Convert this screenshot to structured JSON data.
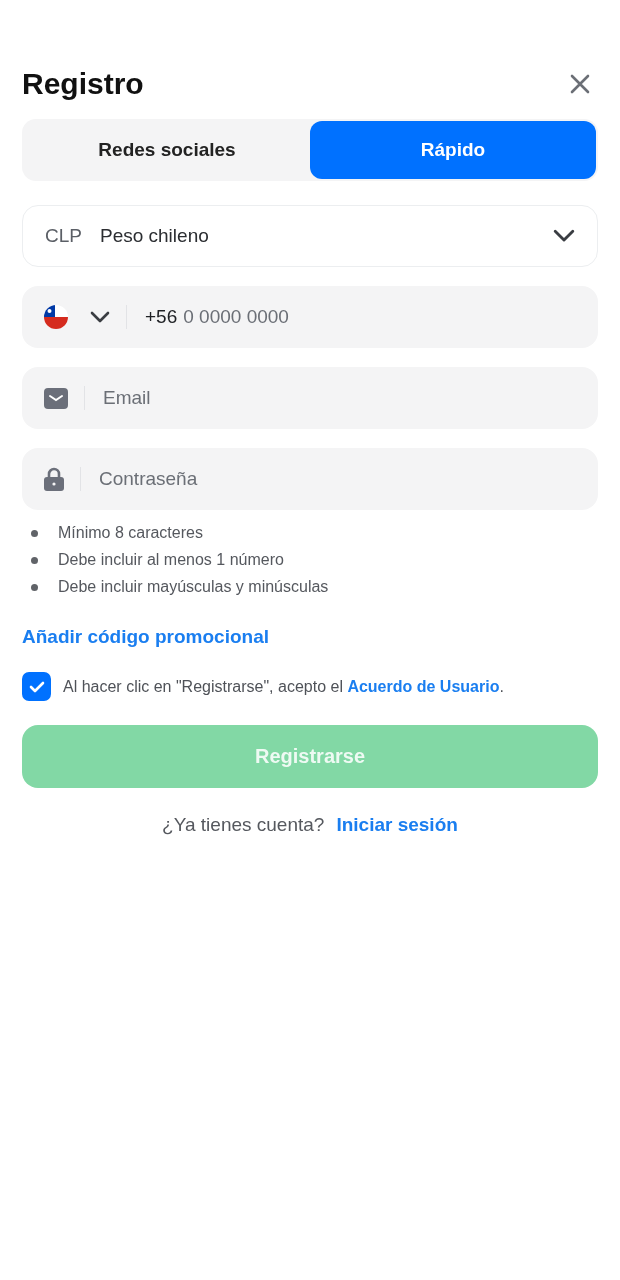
{
  "title": "Registro",
  "tabs": [
    {
      "label": "Redes sociales",
      "selected": false
    },
    {
      "label": "Rápido",
      "selected": true
    }
  ],
  "currency": {
    "code": "CLP",
    "name": "Peso chileno"
  },
  "phone": {
    "prefix": "+56",
    "placeholder": "0 0000 0000"
  },
  "email": {
    "placeholder": "Email"
  },
  "password": {
    "placeholder": "Contraseña"
  },
  "rules": [
    "Mínimo 8 caracteres",
    "Debe incluir al menos 1 número",
    "Debe incluir mayúsculas y minúsculas"
  ],
  "promo_link": "Añadir código promocional",
  "agreement": {
    "checked": true,
    "text": "Al hacer clic en \"Registrarse\", acepto el ",
    "link": "Acuerdo de Usuario",
    "text_after": "."
  },
  "submit": {
    "label": "Registrarse",
    "disabled": true
  },
  "login": {
    "text": "¿Ya tienes cuenta?",
    "link": "Iniciar sesión"
  }
}
